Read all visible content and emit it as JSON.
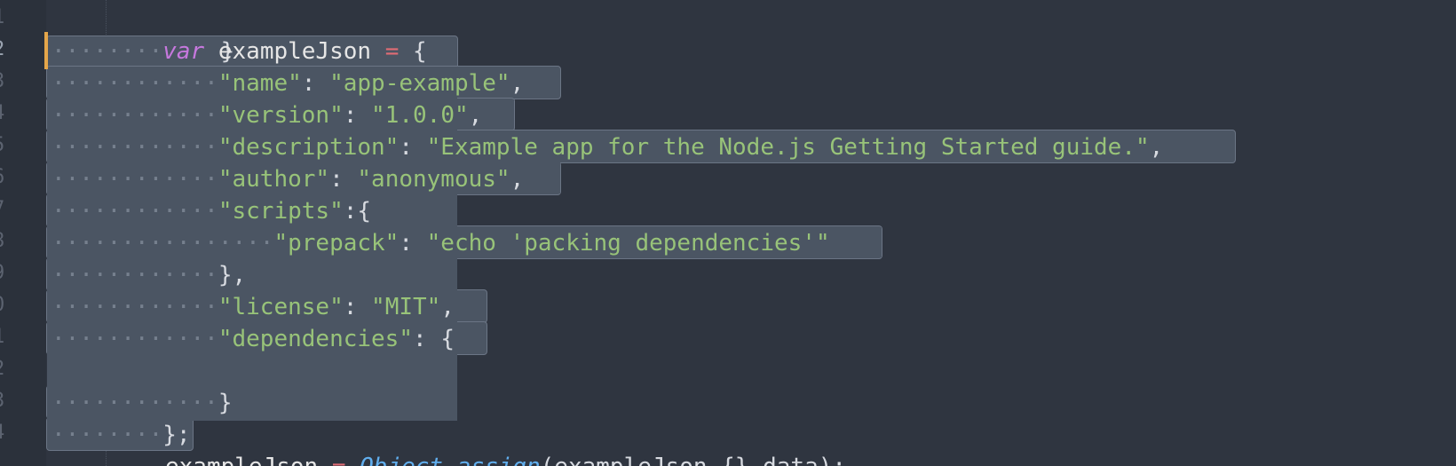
{
  "gutter": {
    "line_numbers": [
      "1",
      "2",
      "3",
      "4",
      "5",
      "6",
      "7",
      "8",
      "9",
      "0",
      "1",
      "2",
      "3",
      "4"
    ]
  },
  "code": {
    "line0": {
      "text": "}"
    },
    "line1": {
      "keyword": "var",
      "ident": "exampleJson",
      "op": "=",
      "brace": "{"
    },
    "line2": {
      "key": "\"name\"",
      "colon": ":",
      "value": "\"app-example\"",
      "comma": ","
    },
    "line3": {
      "key": "\"version\"",
      "colon": ":",
      "value": "\"1.0.0\"",
      "comma": ","
    },
    "line4": {
      "key": "\"description\"",
      "colon": ":",
      "value": "\"Example app for the Node.js Getting Started guide.\"",
      "comma": ","
    },
    "line5": {
      "key": "\"author\"",
      "colon": ":",
      "value": "\"anonymous\"",
      "comma": ","
    },
    "line6": {
      "key": "\"scripts\"",
      "colon": ":",
      "brace": "{"
    },
    "line7": {
      "key": "\"prepack\"",
      "colon": ":",
      "value": "\"echo 'packing dependencies'\""
    },
    "line8": {
      "text": "},"
    },
    "line9": {
      "key": "\"license\"",
      "colon": ":",
      "value": "\"MIT\"",
      "comma": ","
    },
    "line10": {
      "key": "\"dependencies\"",
      "colon": ":",
      "brace": "{"
    },
    "line12": {
      "text": "}"
    },
    "line13": {
      "text": "};"
    },
    "line14": {
      "ident": "exampleJson",
      "op": "=",
      "obj": "Object",
      "dot": ".",
      "fn": "assign",
      "rest": "(exampleJson,{},data);"
    }
  },
  "colors": {
    "background": "#2f3540",
    "selection": "#4b5563",
    "caret_marker": "#e5a64a",
    "string": "#98c379",
    "keyword": "#c678dd",
    "operator": "#e06c75"
  }
}
